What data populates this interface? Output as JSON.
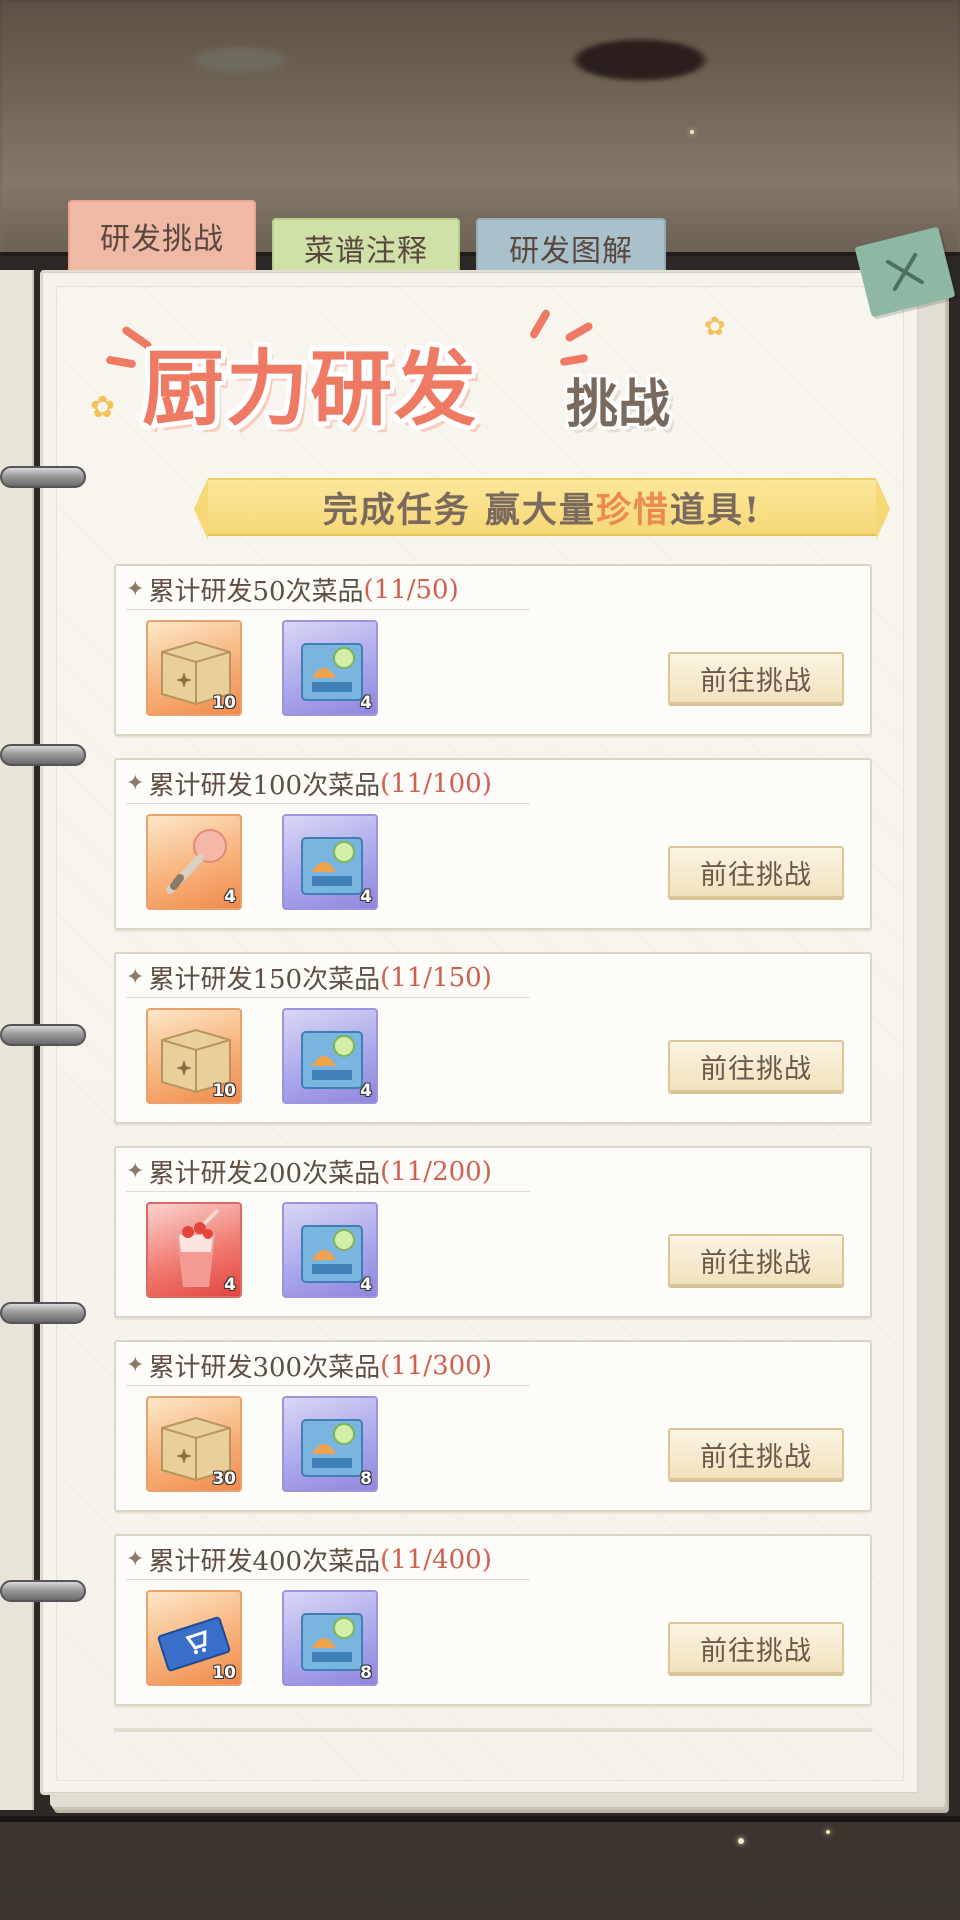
{
  "tabs": [
    {
      "label": "研发挑战",
      "active": true
    },
    {
      "label": "菜谱注释",
      "active": false
    },
    {
      "label": "研发图解",
      "active": false
    }
  ],
  "title": {
    "main": "厨力研发",
    "sub": "挑战"
  },
  "ribbon": {
    "prefix": "完成任务 赢大量",
    "highlight": "珍惜",
    "suffix": "道具!"
  },
  "tasks": [
    {
      "label": "累计研发50次菜品",
      "progress": "(11/50)",
      "button": "前往挑战",
      "rewards": [
        {
          "icon": "cardboard-box-icon",
          "count": "10"
        },
        {
          "icon": "ingredient-crate-icon",
          "count": "4"
        }
      ]
    },
    {
      "label": "累计研发100次菜品",
      "progress": "(11/100)",
      "button": "前往挑战",
      "rewards": [
        {
          "icon": "whisk-icon",
          "count": "4"
        },
        {
          "icon": "ingredient-crate-icon",
          "count": "4"
        }
      ]
    },
    {
      "label": "累计研发150次菜品",
      "progress": "(11/150)",
      "button": "前往挑战",
      "rewards": [
        {
          "icon": "cardboard-box-icon",
          "count": "10"
        },
        {
          "icon": "ingredient-crate-icon",
          "count": "4"
        }
      ]
    },
    {
      "label": "累计研发200次菜品",
      "progress": "(11/200)",
      "button": "前往挑战",
      "rewards": [
        {
          "icon": "strawberry-drink-icon",
          "count": "4"
        },
        {
          "icon": "ingredient-crate-icon",
          "count": "4"
        }
      ]
    },
    {
      "label": "累计研发300次菜品",
      "progress": "(11/300)",
      "button": "前往挑战",
      "rewards": [
        {
          "icon": "cardboard-box-icon",
          "count": "30"
        },
        {
          "icon": "ingredient-crate-icon",
          "count": "8"
        }
      ]
    },
    {
      "label": "累计研发400次菜品",
      "progress": "(11/400)",
      "button": "前往挑战",
      "rewards": [
        {
          "icon": "shopping-ticket-icon",
          "count": "10"
        },
        {
          "icon": "ingredient-crate-icon",
          "count": "8"
        }
      ]
    }
  ],
  "colors": {
    "accent": "#ee7a63",
    "progress": "#cf5f4f",
    "tab_active": "#f0b9a6",
    "tab_green": "#cfe0a8",
    "tab_blue": "#a9c1cb",
    "close": "#8fb8a4"
  }
}
